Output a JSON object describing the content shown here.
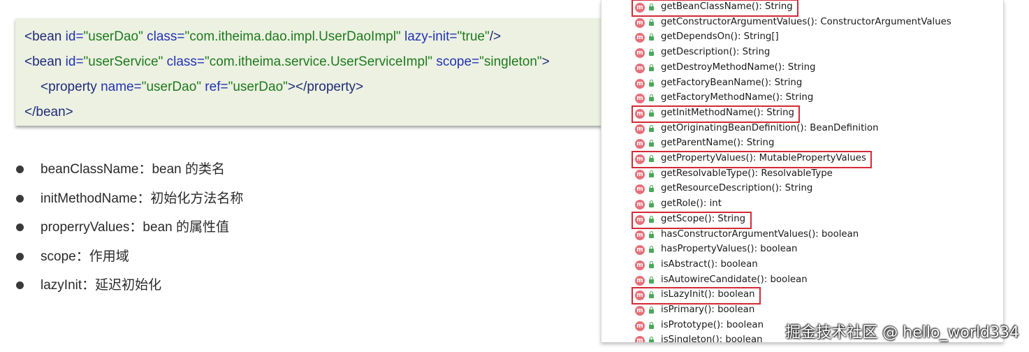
{
  "code": {
    "lines": [
      [
        {
          "text": "<bean ",
          "kind": "tag"
        },
        {
          "text": "id=",
          "kind": "attr"
        },
        {
          "text": "\"userDao\"",
          "kind": "val"
        },
        {
          "text": " class=",
          "kind": "attr"
        },
        {
          "text": "\"com.itheima.dao.impl.UserDaoImpl\"",
          "kind": "val"
        },
        {
          "text": " lazy-init=",
          "kind": "attr"
        },
        {
          "text": "\"true\"",
          "kind": "val"
        },
        {
          "text": "/>",
          "kind": "tag"
        }
      ],
      [
        {
          "text": "<bean ",
          "kind": "tag"
        },
        {
          "text": "id=",
          "kind": "attr"
        },
        {
          "text": "\"userService\"",
          "kind": "val"
        },
        {
          "text": " class=",
          "kind": "attr"
        },
        {
          "text": "\"com.itheima.service.UserServiceImpl\"",
          "kind": "val"
        },
        {
          "text": " scope=",
          "kind": "attr"
        },
        {
          "text": "\"singleton\"",
          "kind": "val"
        },
        {
          "text": ">",
          "kind": "tag"
        }
      ],
      [
        {
          "text": "<property ",
          "kind": "tag"
        },
        {
          "text": "name=",
          "kind": "attr"
        },
        {
          "text": "\"userDao\"",
          "kind": "val"
        },
        {
          "text": " ref=",
          "kind": "attr"
        },
        {
          "text": "\"userDao\"",
          "kind": "val"
        },
        {
          "text": "></property>",
          "kind": "tag"
        }
      ],
      [
        {
          "text": "</bean>",
          "kind": "tag"
        }
      ]
    ]
  },
  "bullets": [
    {
      "text": "beanClassName：bean 的类名"
    },
    {
      "text": "initMethodName：初始化方法名称"
    },
    {
      "text": "properryValues：bean 的属性值"
    },
    {
      "text": "scope：作用域"
    },
    {
      "text": "lazyInit：延迟初始化"
    }
  ],
  "methods": [
    {
      "label": "getBeanClassName(): String",
      "highlighted": true
    },
    {
      "label": "getConstructorArgumentValues(): ConstructorArgumentValues",
      "highlighted": false
    },
    {
      "label": "getDependsOn(): String[]",
      "highlighted": false
    },
    {
      "label": "getDescription(): String",
      "highlighted": false
    },
    {
      "label": "getDestroyMethodName(): String",
      "highlighted": false
    },
    {
      "label": "getFactoryBeanName(): String",
      "highlighted": false
    },
    {
      "label": "getFactoryMethodName(): String",
      "highlighted": false
    },
    {
      "label": "getInitMethodName(): String",
      "highlighted": true
    },
    {
      "label": "getOriginatingBeanDefinition(): BeanDefinition",
      "highlighted": false
    },
    {
      "label": "getParentName(): String",
      "highlighted": false
    },
    {
      "label": "getPropertyValues(): MutablePropertyValues",
      "highlighted": true
    },
    {
      "label": "getResolvableType(): ResolvableType",
      "highlighted": false
    },
    {
      "label": "getResourceDescription(): String",
      "highlighted": false
    },
    {
      "label": "getRole(): int",
      "highlighted": false
    },
    {
      "label": "getScope(): String",
      "highlighted": true
    },
    {
      "label": "hasConstructorArgumentValues(): boolean",
      "highlighted": false
    },
    {
      "label": "hasPropertyValues(): boolean",
      "highlighted": false
    },
    {
      "label": "isAbstract(): boolean",
      "highlighted": false
    },
    {
      "label": "isAutowireCandidate(): boolean",
      "highlighted": false
    },
    {
      "label": "isLazyInit(): boolean",
      "highlighted": true
    },
    {
      "label": "isPrimary(): boolean",
      "highlighted": false
    },
    {
      "label": "isPrototype(): boolean",
      "highlighted": false
    },
    {
      "label": "isSingleton(): boolean",
      "highlighted": false
    }
  ],
  "method_icon_letter": "m",
  "colors": {
    "highlight_border": "#d42a35",
    "code_background": "#ecf1e1",
    "method_icon": "#e6707a",
    "access_icon": "#4aa85a"
  },
  "icons": {
    "method": "method-icon",
    "access": "public-lock-icon"
  },
  "watermark": "掘金技术社区 @ hello_world334"
}
